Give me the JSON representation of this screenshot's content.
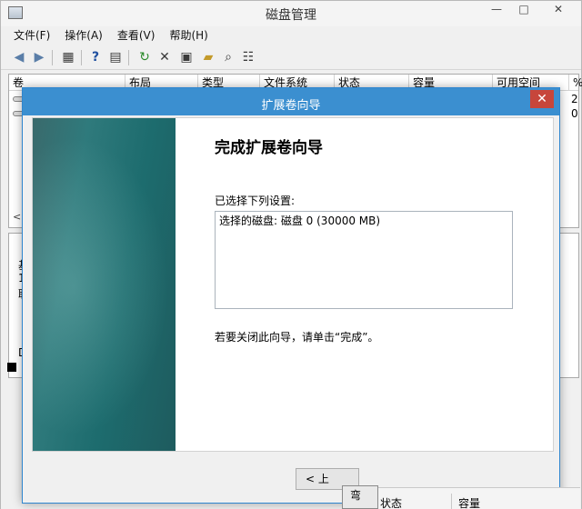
{
  "window": {
    "title": "磁盘管理",
    "minimize": "—",
    "maximize": "□",
    "close": "✕"
  },
  "menu": [
    "文件(F)",
    "操作(A)",
    "查看(V)",
    "帮助(H)"
  ],
  "toolbar_icons": [
    "back-arrow-icon",
    "forward-arrow-icon",
    "console-tree-icon",
    "help-icon",
    "properties-icon",
    "refresh-icon",
    "delete-icon",
    "open-icon",
    "folder-icon",
    "search-icon",
    "settings-icon"
  ],
  "volume_table": {
    "columns": [
      "卷",
      "布局",
      "类型",
      "文件系统",
      "状态",
      "容量",
      "可用空间",
      "%"
    ],
    "row_values": [
      "2",
      "0"
    ]
  },
  "lower_fragments": {
    "left_chars": [
      "基",
      "1",
      "联",
      "D"
    ],
    "scroll_left": "<"
  },
  "wizard": {
    "title": "扩展卷向导",
    "close": "✕",
    "heading": "完成扩展卷向导",
    "selected_label": "已选择下列设置:",
    "summary_line": "选择的磁盘: 磁盘 0 (30000 MB)",
    "hint": "若要关闭此向导，请单击“完成”。",
    "back_button": "< 上"
  },
  "bottom_overlap": {
    "button_fragment": "弯",
    "col_status": "状态",
    "col_capacity": "容量"
  }
}
